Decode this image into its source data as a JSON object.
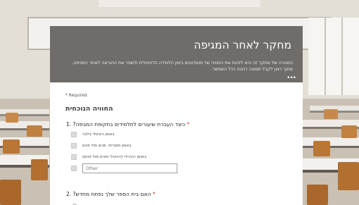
{
  "form": {
    "title": "מחקר לאחר המגיפה",
    "description": "המטרה של מחקר זה היא לזהות את החוויה של סטודנטים בזמן הלמידה הדיגיטלית ולשפר את ההוראה לאחר המגיפה, מתוך רצון לקבל תמונה רחבה ככל האפשר.",
    "more_label": "•••",
    "required_note": "* Required"
  },
  "section": {
    "title": "החוויה הנוכחית"
  },
  "questions": [
    {
      "number": "1.",
      "text": "כיצד העברת שיעורים לתלמידים בתקופת המגיפה?",
      "required_mark": "*",
      "options": [
        "באופן דיגיטלי בלבד",
        "באופן מסורתי, פנים מול פנים",
        "באופן היברידי (דיגיטלי ופנים מול פנים)"
      ],
      "other_placeholder": "Other"
    },
    {
      "number": "2.",
      "text": "האם בית הספר שלך נפתח מחדש?",
      "required_mark": "*"
    }
  ],
  "colors": {
    "header_bg": "#6f6c69",
    "card_bg": "#ffffff",
    "required": "#d93025"
  }
}
